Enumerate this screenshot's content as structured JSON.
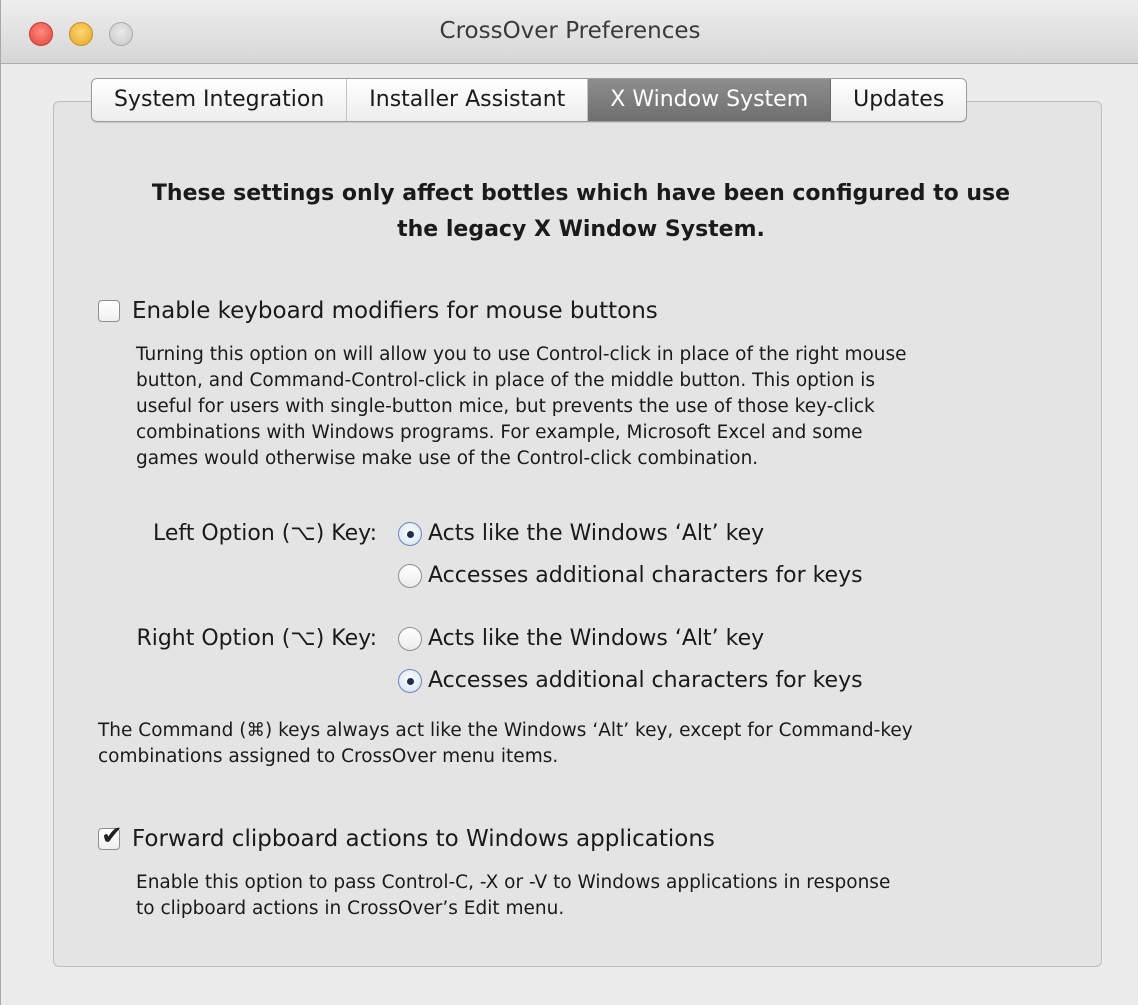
{
  "window": {
    "title": "CrossOver Preferences"
  },
  "tabs": [
    {
      "label": "System Integration",
      "active": false
    },
    {
      "label": "Installer Assistant",
      "active": false
    },
    {
      "label": "X Window System",
      "active": true
    },
    {
      "label": "Updates",
      "active": false
    }
  ],
  "headline": {
    "line1": "These settings only affect bottles which have been configured to use",
    "line2": "the legacy X Window System."
  },
  "keyboard_modifiers": {
    "label": "Enable keyboard modifiers for mouse buttons",
    "checked": false,
    "description": [
      "Turning this option on will allow you to use Control-click in place of the right mouse",
      "button, and Command-Control-click in place of the middle button. This option is",
      "useful for users with single-button mice, but prevents the use of those key-click",
      "combinations with Windows programs. For example, Microsoft Excel and some",
      "games would otherwise make use of the Control-click combination."
    ]
  },
  "left_option": {
    "label": "Left Option (⌥) Key:",
    "options": [
      {
        "label": "Acts like the Windows ‘Alt’ key",
        "selected": true
      },
      {
        "label": "Accesses additional characters for keys",
        "selected": false
      }
    ]
  },
  "right_option": {
    "label": "Right Option (⌥) Key:",
    "options": [
      {
        "label": "Acts like the Windows ‘Alt’ key",
        "selected": false
      },
      {
        "label": "Accesses additional characters for keys",
        "selected": true
      }
    ]
  },
  "command_note": [
    "The Command (⌘) keys always act like the Windows ‘Alt’ key, except for Command-key",
    "combinations assigned to CrossOver menu items."
  ],
  "clipboard": {
    "label": "Forward clipboard actions to Windows applications",
    "checked": true,
    "description": [
      "Enable this option to pass Control-C, -X or -V to Windows applications in response",
      "to clipboard actions in CrossOver’s Edit menu."
    ]
  }
}
